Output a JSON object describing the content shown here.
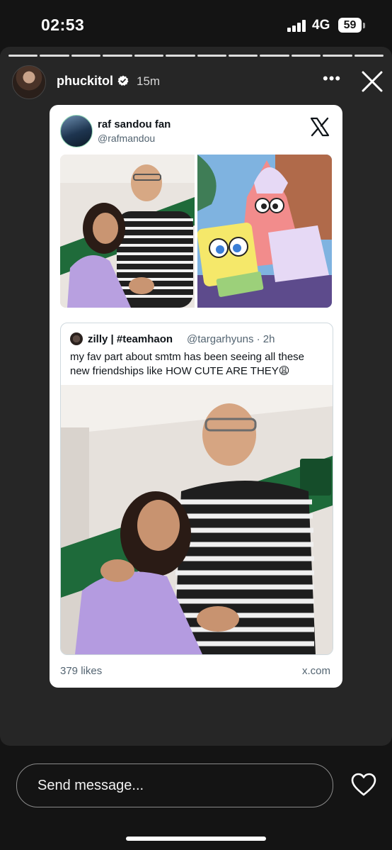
{
  "status_bar": {
    "time": "02:53",
    "network": "4G",
    "battery": "59"
  },
  "story": {
    "username": "phuckitol",
    "time_ago": "15m",
    "progress_segments": 12,
    "progress_current": 12
  },
  "tweet": {
    "author_name": "raf sandou fan",
    "author_handle": "@rafmandou",
    "platform_icon": "x-logo-icon",
    "images": [
      "photo-couple",
      "spongebob-patrick-meme"
    ],
    "quote": {
      "author_name": "zilly | #teamhaon",
      "author_handle": "@targarhyuns · 2h",
      "text": "my fav part about smtm has been seeing all these new friendships like HOW CUTE ARE THEY😩"
    },
    "likes": "379 likes",
    "domain": "x.com"
  },
  "bottom_bar": {
    "message_placeholder": "Send message..."
  },
  "colors": {
    "background": "#141414",
    "story_bg": "#262626",
    "card": "#ffffff",
    "secondary_text": "#536471"
  }
}
